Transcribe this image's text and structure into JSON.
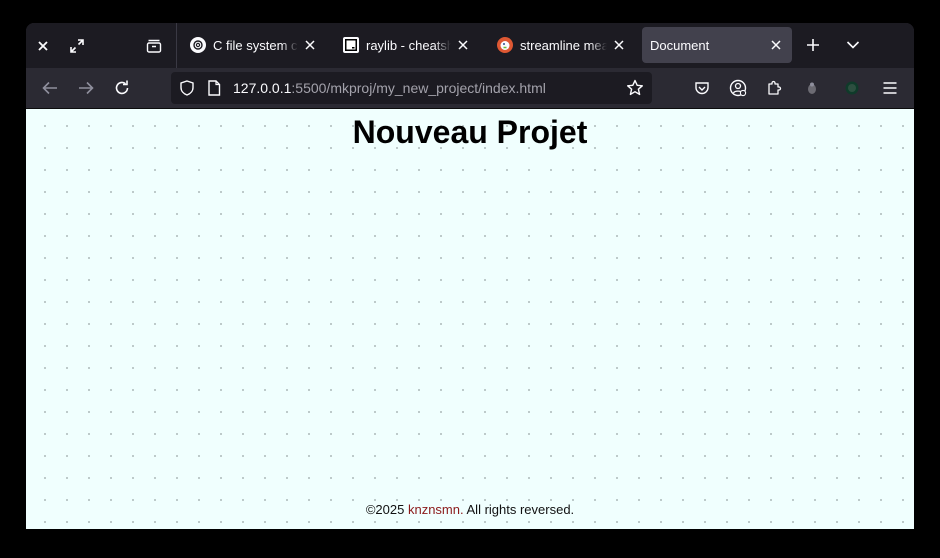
{
  "browser": {
    "tabs": [
      {
        "title": "C file system con",
        "icon": "openai-favicon"
      },
      {
        "title": "raylib - cheatshe",
        "icon": "raylib-favicon"
      },
      {
        "title": "streamline meani",
        "icon": "duckduckgo-favicon"
      },
      {
        "title": "Document",
        "icon": "none",
        "active": true
      }
    ],
    "url": {
      "host": "127.0.0.1",
      "path": ":5500/mkproj/my_new_project/index.html"
    },
    "colors": {
      "chrome_dark": "#1c1b22",
      "chrome": "#2b2a33",
      "active_tab": "#42414d",
      "text": "#fbfbfe"
    }
  },
  "page": {
    "title": "Nouveau Projet",
    "background": "#f0fffe",
    "footer": {
      "copyright_symbol": "©",
      "year": "2025",
      "brand": "knznsmn.",
      "rights": "All rights reversed.",
      "brand_color": "#8b1a1a"
    }
  }
}
